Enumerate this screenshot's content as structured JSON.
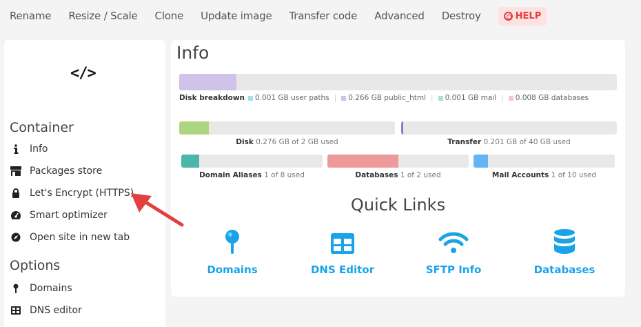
{
  "topbar": {
    "actions": [
      "Rename",
      "Resize / Scale",
      "Clone",
      "Update image",
      "Transfer code",
      "Advanced",
      "Destroy"
    ],
    "help_label": "HELP"
  },
  "sidebar": {
    "logo": "</>",
    "container_title": "Container",
    "container_items": [
      {
        "label": "Info",
        "icon": "info-icon"
      },
      {
        "label": "Packages store",
        "icon": "store-icon"
      },
      {
        "label": "Let's Encrypt (HTTPS)",
        "icon": "lock-icon"
      },
      {
        "label": "Smart optimizer",
        "icon": "gauge-icon"
      },
      {
        "label": "Open site in new tab",
        "icon": "compass-icon"
      }
    ],
    "options_title": "Options",
    "options_items": [
      {
        "label": "Domains",
        "icon": "pin-icon"
      },
      {
        "label": "DNS editor",
        "icon": "table-icon"
      }
    ]
  },
  "info": {
    "title": "Info",
    "disk_breakdown": {
      "label": "Disk breakdown",
      "segments": [
        {
          "text": "0.001 GB user paths",
          "color": "#a8dcef"
        },
        {
          "text": "0.266 GB public_html",
          "color": "#cfc3ea"
        },
        {
          "text": "0.001 GB mail",
          "color": "#a9dedd"
        },
        {
          "text": "0.008 GB databases",
          "color": "#f6c6c6"
        }
      ],
      "fill_fraction": 0.13
    },
    "disk": {
      "label": "Disk",
      "text": "0.276 GB of 2 GB used",
      "fraction": 0.138,
      "color": "#aed581"
    },
    "transfer": {
      "label": "Transfer",
      "text": "0.201 GB of 40 GB used",
      "fraction": 0.005,
      "color": "#9575cd"
    },
    "domain_aliases": {
      "label": "Domain Aliases",
      "text": "1 of 8 used",
      "fraction": 0.125,
      "color": "#4db6ac"
    },
    "databases": {
      "label": "Databases",
      "text": "1 of 2 used",
      "fraction": 0.5,
      "color": "#ef9a9a"
    },
    "mail_accounts": {
      "label": "Mail Accounts",
      "text": "1 of 10 used",
      "fraction": 0.1,
      "color": "#64b5f6"
    }
  },
  "quick_links": {
    "title": "Quick Links",
    "items": [
      {
        "label": "Domains",
        "icon": "pin-icon"
      },
      {
        "label": "DNS Editor",
        "icon": "table-icon"
      },
      {
        "label": "SFTP Info",
        "icon": "wifi-icon"
      },
      {
        "label": "Databases",
        "icon": "database-icon"
      }
    ]
  },
  "colors": {
    "accent": "#1aa3e8",
    "help": "#e53e3e",
    "arrow": "#e04040"
  }
}
